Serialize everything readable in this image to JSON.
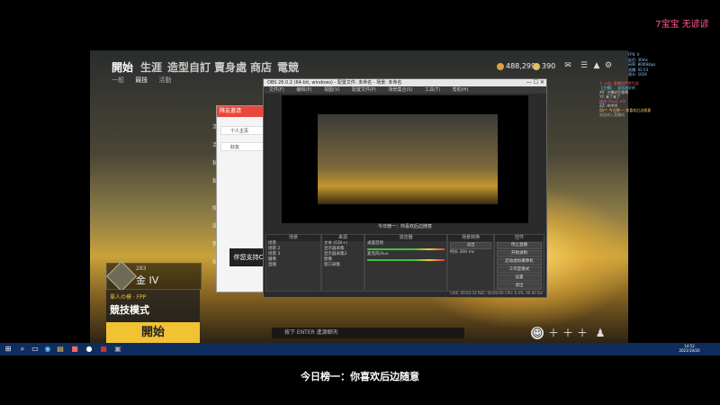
{
  "overlay": {
    "brand": "7宝宝 无谚谚",
    "subtitle": "今日榜一：你喜欢后边随意"
  },
  "game": {
    "nav_tabs": [
      "開始",
      "生涯",
      "造型自訂",
      "賣身處",
      "商店",
      "電競"
    ],
    "sub_nav": [
      "一般",
      "競技",
      "活動"
    ],
    "currency": {
      "bp": "488,299",
      "g": "390"
    },
    "rank": {
      "label": "金 IV",
      "level": "283"
    },
    "mode": {
      "caption": "單人の模 · FPP",
      "name": "競技模式"
    },
    "start_label": "開始",
    "chat_placeholder": "按下 ENTER 進源聊天",
    "side_menu": [
      "活動",
      "活動",
      "私人",
      "私人",
      "組",
      "語",
      "新",
      "私人"
    ],
    "popup": {
      "title": "隊友邀请",
      "items": [
        "个人主页",
        "好友"
      ]
    },
    "popup_banner": "伴您支持C",
    "colors": {
      "accent": "#f1c232"
    }
  },
  "obs": {
    "title": "OBS 26.0.2 (64-bit, windows) - 配置文件: 未命名 - 场景: 未命名",
    "menu": [
      "文件(F)",
      "编辑(E)",
      "视图(V)",
      "配置文件(P)",
      "场景集合(S)",
      "工具(T)",
      "帮助(H)"
    ],
    "preview_caption": "今日榜一：你喜欢后边随意",
    "docks": {
      "scenes": {
        "title": "场景",
        "items": [
          "场景",
          "场景 2",
          "场景 3",
          "摄像",
          "直播"
        ]
      },
      "sources": {
        "title": "来源",
        "items": [
          "文本 (GDI+)",
          "显示器采集",
          "显示器采集2",
          "图像",
          "窗口采集"
        ]
      },
      "mixer": {
        "title": "混音器",
        "items": [
          "桌面音频",
          "麦克风/Aux"
        ]
      },
      "transitions": {
        "title": "场景转换",
        "items": [
          "淡出",
          "时长 300 ms"
        ]
      },
      "controls": {
        "title": "控件",
        "items": [
          "停止直播",
          "开始录制",
          "启动虚拟摄像机",
          "工作室模式",
          "设置",
          "退出"
        ]
      }
    },
    "status": "LIVE: 00:02:53  REC: 00:00:00  CPU: 6.4%, 60.00 fps"
  },
  "stats": [
    "FPS: 0",
    "延迟: 30ms",
    "码率: 8000kbps",
    "直播: 02:53",
    "观众: 1024"
  ],
  "chat": [
    "1·  公告: 直播间严禁引战",
    "【主播】：说话很好听",
    "XX: 主播好厉害啊",
    "YY: 来了来了",
    "送出 小心心 ×1",
    "ZZ: 冲冲冲",
    "用户: 今日榜一: 你喜欢后边随意",
    "欢迎进入直播间"
  ],
  "taskbar": {
    "time": "14:52",
    "date": "2021/10/20"
  }
}
